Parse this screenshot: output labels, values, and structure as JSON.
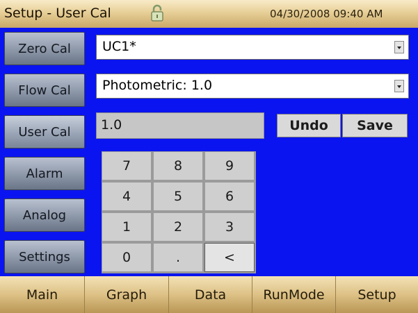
{
  "header": {
    "title": "Setup - User Cal",
    "datetime": "04/30/2008 09:40 AM",
    "lock_icon": "lock-icon"
  },
  "sidebar": {
    "items": [
      {
        "label": "Zero Cal"
      },
      {
        "label": "Flow Cal"
      },
      {
        "label": "User Cal"
      },
      {
        "label": "Alarm"
      },
      {
        "label": "Analog"
      },
      {
        "label": "Settings"
      }
    ]
  },
  "main": {
    "cal_select": {
      "value": "UC1*"
    },
    "mode_select": {
      "value": "Photometric: 1.0"
    },
    "value_field": {
      "value": "1.0"
    },
    "undo_label": "Undo",
    "save_label": "Save",
    "keypad": {
      "keys": [
        "7",
        "8",
        "9",
        "4",
        "5",
        "6",
        "1",
        "2",
        "3",
        "0",
        ".",
        "<"
      ]
    }
  },
  "bottom_nav": {
    "items": [
      {
        "label": "Main"
      },
      {
        "label": "Graph"
      },
      {
        "label": "Data"
      },
      {
        "label": "RunMode"
      },
      {
        "label": "Setup"
      }
    ]
  },
  "colors": {
    "background": "#0a14f0",
    "title_bar": "#e7cf97",
    "side_tab": "#8c97a8",
    "keypad": "#cfcfcf"
  }
}
